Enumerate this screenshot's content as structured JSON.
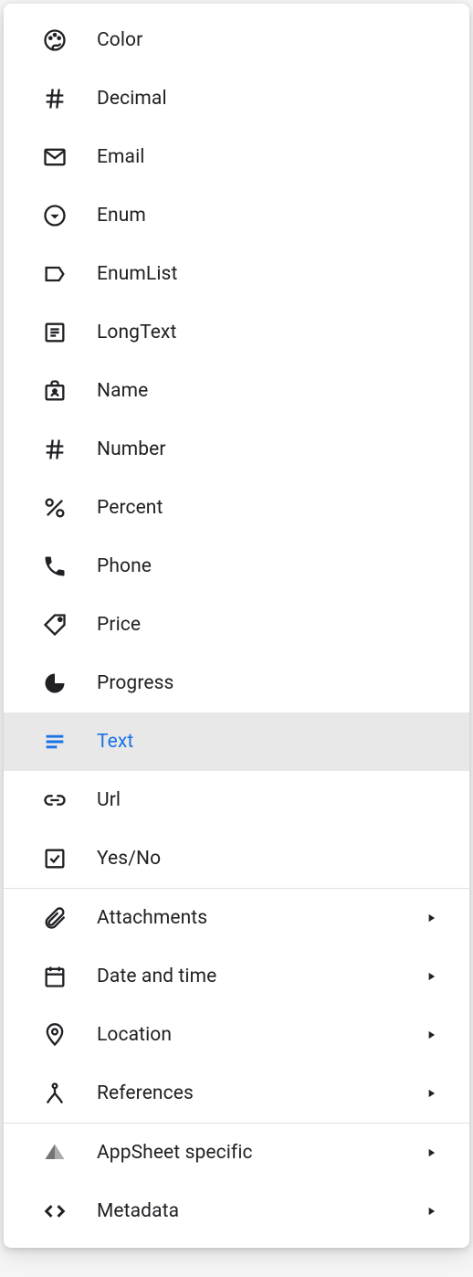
{
  "menu": {
    "groups": [
      {
        "items": [
          {
            "id": "color",
            "label": "Color",
            "icon": "palette-icon",
            "hasSubmenu": false,
            "selected": false
          },
          {
            "id": "decimal",
            "label": "Decimal",
            "icon": "hash-icon",
            "hasSubmenu": false,
            "selected": false
          },
          {
            "id": "email",
            "label": "Email",
            "icon": "email-icon",
            "hasSubmenu": false,
            "selected": false
          },
          {
            "id": "enum",
            "label": "Enum",
            "icon": "enum-icon",
            "hasSubmenu": false,
            "selected": false
          },
          {
            "id": "enumlist",
            "label": "EnumList",
            "icon": "label-icon",
            "hasSubmenu": false,
            "selected": false
          },
          {
            "id": "longtext",
            "label": "LongText",
            "icon": "longtext-icon",
            "hasSubmenu": false,
            "selected": false
          },
          {
            "id": "name",
            "label": "Name",
            "icon": "badge-icon",
            "hasSubmenu": false,
            "selected": false
          },
          {
            "id": "number",
            "label": "Number",
            "icon": "hash-icon",
            "hasSubmenu": false,
            "selected": false
          },
          {
            "id": "percent",
            "label": "Percent",
            "icon": "percent-icon",
            "hasSubmenu": false,
            "selected": false
          },
          {
            "id": "phone",
            "label": "Phone",
            "icon": "phone-icon",
            "hasSubmenu": false,
            "selected": false
          },
          {
            "id": "price",
            "label": "Price",
            "icon": "tag-icon",
            "hasSubmenu": false,
            "selected": false
          },
          {
            "id": "progress",
            "label": "Progress",
            "icon": "progress-icon",
            "hasSubmenu": false,
            "selected": false
          },
          {
            "id": "text",
            "label": "Text",
            "icon": "text-icon",
            "hasSubmenu": false,
            "selected": true
          },
          {
            "id": "url",
            "label": "Url",
            "icon": "link-icon",
            "hasSubmenu": false,
            "selected": false
          },
          {
            "id": "yesno",
            "label": "Yes/No",
            "icon": "checkbox-icon",
            "hasSubmenu": false,
            "selected": false
          }
        ]
      },
      {
        "items": [
          {
            "id": "attachments",
            "label": "Attachments",
            "icon": "attachment-icon",
            "hasSubmenu": true,
            "selected": false
          },
          {
            "id": "datetime",
            "label": "Date and time",
            "icon": "calendar-icon",
            "hasSubmenu": true,
            "selected": false
          },
          {
            "id": "location",
            "label": "Location",
            "icon": "location-icon",
            "hasSubmenu": true,
            "selected": false
          },
          {
            "id": "references",
            "label": "References",
            "icon": "references-icon",
            "hasSubmenu": true,
            "selected": false
          }
        ]
      },
      {
        "items": [
          {
            "id": "appsheet",
            "label": "AppSheet specific",
            "icon": "appsheet-icon",
            "hasSubmenu": true,
            "selected": false
          },
          {
            "id": "metadata",
            "label": "Metadata",
            "icon": "code-icon",
            "hasSubmenu": true,
            "selected": false
          }
        ]
      }
    ]
  },
  "colors": {
    "accent": "#1a73e8",
    "text": "#202124",
    "selectedBg": "#e8e8e8",
    "divider": "#e0e0e0"
  }
}
